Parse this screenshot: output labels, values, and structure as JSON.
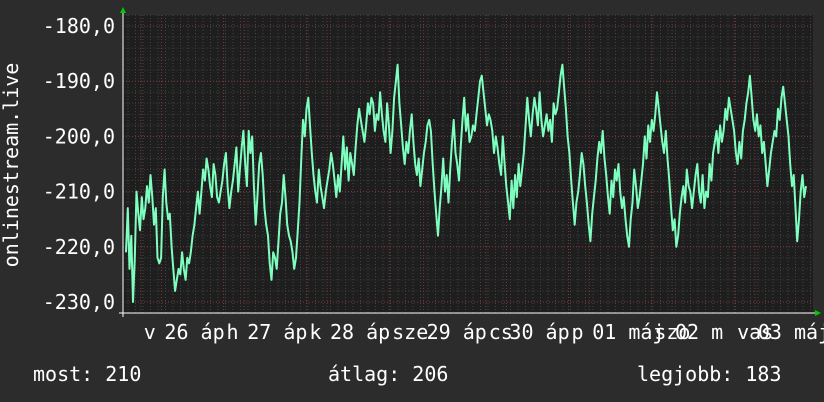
{
  "chart_data": {
    "type": "line",
    "ylabel": "onlinestream.live",
    "ylim": [
      -232,
      -178
    ],
    "yticks": [
      "-180,0",
      "-190,0",
      "-200,0",
      "-210,0",
      "-220,0",
      "-230,0"
    ],
    "ytick_values": [
      -180,
      -190,
      -200,
      -210,
      -220,
      -230
    ],
    "xlim": [
      0,
      1
    ],
    "xticks": [
      {
        "label": "v",
        "pos": 0.017
      },
      {
        "label": "26 áp",
        "pos": 0.047
      },
      {
        "label": "h",
        "pos": 0.137
      },
      {
        "label": "27 áp",
        "pos": 0.167
      },
      {
        "label": "k",
        "pos": 0.257
      },
      {
        "label": "28 áp",
        "pos": 0.287
      },
      {
        "label": "sze",
        "pos": 0.377
      },
      {
        "label": "29 áp",
        "pos": 0.427
      },
      {
        "label": "cs",
        "pos": 0.517
      },
      {
        "label": "30 áp",
        "pos": 0.547
      },
      {
        "label": "p",
        "pos": 0.637
      },
      {
        "label": "01 máj",
        "pos": 0.667
      },
      {
        "label": "szo",
        "pos": 0.757
      },
      {
        "label": "02 m",
        "pos": 0.787
      },
      {
        "label": "vas",
        "pos": 0.877
      },
      {
        "label": "03 máj",
        "pos": 0.907
      }
    ],
    "grid": true,
    "line_color": "#7fffbf",
    "series": [
      {
        "values": [
          -221,
          -213,
          -224,
          -218,
          -230,
          -222,
          -210,
          -214,
          -217,
          -211,
          -215,
          -213,
          -209,
          -212,
          -207,
          -211,
          -216,
          -213,
          -222,
          -223,
          -222,
          -211,
          -206,
          -212,
          -215,
          -214,
          -220,
          -224,
          -228,
          -226,
          -224,
          -225,
          -221,
          -224,
          -226,
          -222,
          -223,
          -221,
          -218,
          -216,
          -213,
          -210,
          -214,
          -210,
          -206,
          -208,
          -204,
          -206,
          -209,
          -211,
          -205,
          -207,
          -211,
          -212,
          -210,
          -208,
          -205,
          -203,
          -209,
          -213,
          -210,
          -208,
          -205,
          -202,
          -210,
          -206,
          -202,
          -199,
          -205,
          -209,
          -199,
          -203,
          -200,
          -209,
          -216,
          -211,
          -205,
          -203,
          -207,
          -213,
          -216,
          -218,
          -223,
          -226,
          -221,
          -222,
          -224,
          -219,
          -214,
          -212,
          -207,
          -211,
          -216,
          -218,
          -219,
          -221,
          -224,
          -222,
          -217,
          -212,
          -204,
          -197,
          -200,
          -195,
          -193,
          -198,
          -203,
          -207,
          -210,
          -212,
          -206,
          -209,
          -211,
          -213,
          -210,
          -208,
          -206,
          -203,
          -205,
          -208,
          -211,
          -207,
          -210,
          -205,
          -200,
          -206,
          -202,
          -208,
          -203,
          -205,
          -207,
          -202,
          -198,
          -195,
          -197,
          -199,
          -201,
          -198,
          -194,
          -196,
          -193,
          -194,
          -199,
          -196,
          -197,
          -192,
          -196,
          -199,
          -201,
          -194,
          -198,
          -203,
          -199,
          -193,
          -190,
          -187,
          -194,
          -198,
          -202,
          -205,
          -201,
          -203,
          -199,
          -196,
          -201,
          -205,
          -207,
          -204,
          -209,
          -206,
          -203,
          -201,
          -198,
          -197,
          -199,
          -205,
          -210,
          -214,
          -218,
          -213,
          -209,
          -204,
          -210,
          -207,
          -212,
          -206,
          -201,
          -197,
          -203,
          -205,
          -208,
          -202,
          -197,
          -193,
          -199,
          -196,
          -201,
          -200,
          -198,
          -199,
          -196,
          -193,
          -190,
          -189,
          -192,
          -195,
          -198,
          -196,
          -197,
          -199,
          -203,
          -200,
          -202,
          -205,
          -207,
          -200,
          -205,
          -209,
          -212,
          -215,
          -208,
          -213,
          -207,
          -211,
          -205,
          -209,
          -206,
          -203,
          -198,
          -193,
          -197,
          -200,
          -196,
          -193,
          -195,
          -198,
          -192,
          -197,
          -200,
          -198,
          -196,
          -199,
          -197,
          -201,
          -194,
          -196,
          -195,
          -192,
          -189,
          -187,
          -191,
          -195,
          -200,
          -203,
          -208,
          -212,
          -216,
          -212,
          -210,
          -207,
          -203,
          -205,
          -209,
          -212,
          -216,
          -219,
          -214,
          -211,
          -208,
          -204,
          -201,
          -203,
          -199,
          -204,
          -207,
          -211,
          -214,
          -208,
          -211,
          -206,
          -208,
          -205,
          -210,
          -213,
          -211,
          -215,
          -218,
          -220,
          -215,
          -212,
          -206,
          -209,
          -213,
          -211,
          -208,
          -205,
          -200,
          -204,
          -198,
          -201,
          -197,
          -199,
          -196,
          -192,
          -195,
          -198,
          -201,
          -203,
          -199,
          -204,
          -208,
          -213,
          -217,
          -215,
          -220,
          -218,
          -214,
          -211,
          -209,
          -212,
          -206,
          -209,
          -210,
          -213,
          -210,
          -207,
          -205,
          -210,
          -212,
          -207,
          -213,
          -210,
          -211,
          -205,
          -208,
          -203,
          -201,
          -199,
          -203,
          -198,
          -201,
          -199,
          -195,
          -197,
          -193,
          -195,
          -197,
          -199,
          -203,
          -205,
          -201,
          -204,
          -199,
          -197,
          -194,
          -192,
          -189,
          -193,
          -197,
          -199,
          -196,
          -200,
          -198,
          -203,
          -201,
          -205,
          -209,
          -206,
          -203,
          -201,
          -199,
          -200,
          -195,
          -197,
          -193,
          -191,
          -194,
          -197,
          -200,
          -205,
          -209,
          -207,
          -213,
          -219,
          -215,
          -210,
          -207,
          -211,
          -209
        ]
      }
    ]
  },
  "footer": {
    "current": "most: 210",
    "average": "átlag: 206",
    "best": "legjobb: 183"
  }
}
